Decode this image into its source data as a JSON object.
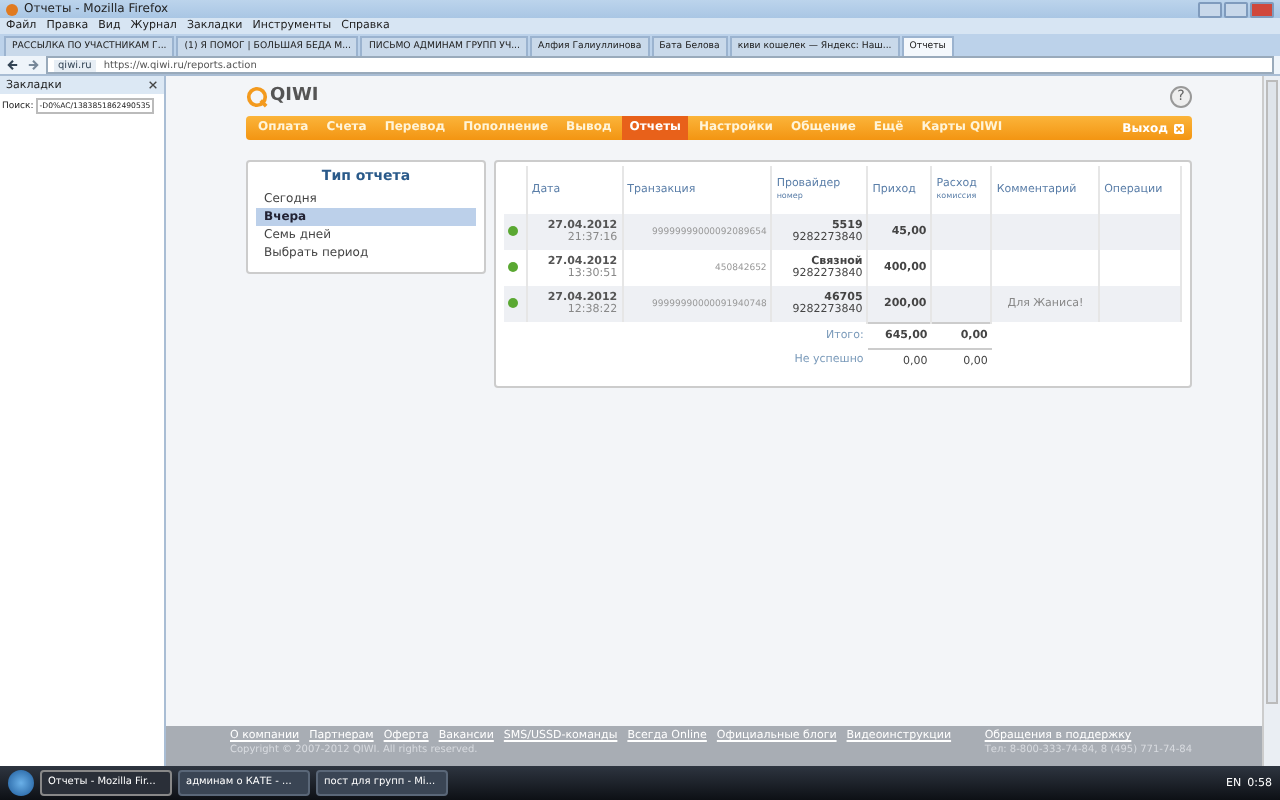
{
  "window": {
    "title": "Отчеты - Mozilla Firefox"
  },
  "menu": [
    "Файл",
    "Правка",
    "Вид",
    "Журнал",
    "Закладки",
    "Инструменты",
    "Справка"
  ],
  "tabs": [
    {
      "label": "РАССЫЛКА ПО УЧАСТНИКАМ Г...",
      "selected": false
    },
    {
      "label": "(1) Я ПОМОГ | БОЛЬШАЯ БЕДА М...",
      "selected": false
    },
    {
      "label": "ПИСЬМО АДМИНАМ ГРУПП УЧ...",
      "selected": false
    },
    {
      "label": "Алфия Галиуллинова",
      "selected": false
    },
    {
      "label": "Бата Белова",
      "selected": false
    },
    {
      "label": "киви кошелек — Яндекс: Наш...",
      "selected": false
    },
    {
      "label": "Отчеты",
      "selected": true
    }
  ],
  "address": {
    "site": "qiwi.ru",
    "url": "https://w.qiwi.ru/reports.action"
  },
  "sidebar": {
    "title": "Закладки",
    "search_label": "Поиск:",
    "search_value": "-D0%AC/1383851862490535"
  },
  "logo": "QIWI",
  "help": "?",
  "nav": [
    {
      "label": "Оплата",
      "selected": false
    },
    {
      "label": "Счета",
      "selected": false
    },
    {
      "label": "Перевод",
      "selected": false
    },
    {
      "label": "Пополнение",
      "selected": false
    },
    {
      "label": "Вывод",
      "selected": false
    },
    {
      "label": "Отчеты",
      "selected": true
    },
    {
      "label": "Настройки",
      "selected": false
    },
    {
      "label": "Общение",
      "selected": false
    },
    {
      "label": "Ещё",
      "selected": false
    },
    {
      "label": "Карты QIWI",
      "selected": false
    }
  ],
  "logout": "Выход",
  "report_type": {
    "title": "Тип отчета",
    "items": [
      {
        "label": "Сегодня",
        "selected": false
      },
      {
        "label": "Вчера",
        "selected": true
      },
      {
        "label": "Семь дней",
        "selected": false
      },
      {
        "label": "Выбрать период",
        "selected": false
      }
    ]
  },
  "table": {
    "columns": [
      {
        "label": "Дата"
      },
      {
        "label": "Транзакция"
      },
      {
        "label": "Провайдер",
        "sub": "номер"
      },
      {
        "label": "Приход"
      },
      {
        "label": "Расход",
        "sub": "комиссия"
      },
      {
        "label": "Комментарий"
      },
      {
        "label": "Операции"
      }
    ],
    "rows": [
      {
        "color": "#5aa832",
        "date": "27.04.2012",
        "time": "21:37:16",
        "transaction": "99999999000092089654",
        "provider": "5519",
        "number": "9282273840",
        "income": "45,00",
        "comment": ""
      },
      {
        "color": "#5aa832",
        "date": "27.04.2012",
        "time": "13:30:51",
        "transaction": "450842652",
        "provider": "Связной",
        "number": "9282273840",
        "income": "400,00",
        "comment": ""
      },
      {
        "color": "#5aa832",
        "date": "27.04.2012",
        "time": "12:38:22",
        "transaction": "99999990000091940748",
        "provider": "46705",
        "number": "9282273840",
        "income": "200,00",
        "comment": "Для Жаниса!"
      }
    ],
    "totals": [
      {
        "label": "Итого:",
        "income": "645,00",
        "expense": "0,00"
      },
      {
        "label": "Не успешно",
        "income": "0,00",
        "expense": "0,00"
      }
    ]
  },
  "footer": {
    "links": [
      "О компании",
      "Партнерам",
      "Оферта",
      "Вакансии",
      "SMS/USSD-команды",
      "Всегда Online",
      "Официальные блоги",
      "Видеоинструкции"
    ],
    "copyright": "Copyright © 2007-2012 QIWI. All rights reserved.",
    "support": "Обращения в поддержку",
    "phone": "Тел: 8-800-333-74-84, 8 (495) 771-74-84"
  },
  "taskbar": {
    "tasks": [
      {
        "label": "Отчеты - Mozilla Fir...",
        "selected": true
      },
      {
        "label": "админам о КАТЕ - ...",
        "selected": false
      },
      {
        "label": "пост для групп - Mi...",
        "selected": false
      }
    ],
    "lang": "EN",
    "clock": "0:58"
  }
}
